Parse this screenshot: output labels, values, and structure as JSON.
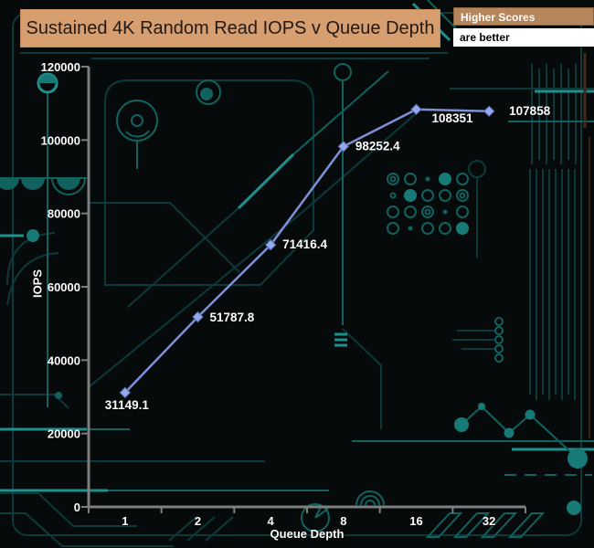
{
  "header": {
    "title": "Sustained 4K Random Read IOPS v Queue Depth",
    "legend": {
      "line1": "Higher Scores",
      "line2": "are better"
    }
  },
  "chart_data": {
    "type": "line",
    "title": "Sustained 4K Random Read IOPS v Queue Depth",
    "xlabel": "Queue Depth",
    "ylabel": "IOPS",
    "categories": [
      "1",
      "2",
      "4",
      "8",
      "16",
      "32"
    ],
    "series": [
      {
        "name": "Sustained 4K Random Read IOPS",
        "values": [
          31149.1,
          51787.8,
          71416.4,
          98252.4,
          108351,
          107858
        ]
      }
    ],
    "point_labels": [
      "31149.1",
      "51787.8",
      "71416.4",
      "98252.4",
      "108351",
      "107858"
    ],
    "ylim": [
      0,
      120000
    ],
    "y_ticks": [
      0,
      20000,
      40000,
      60000,
      80000,
      100000,
      120000
    ],
    "grid": false,
    "legend_position": "none",
    "marker": "diamond",
    "colors": {
      "line": "#7e91d8",
      "marker": "#96a9ea",
      "marker_edge": "#5b6fb8",
      "axis": "#7f7f7f",
      "label": "#ffffff",
      "title_bg": "#d79e6f",
      "title_text": "#221a12",
      "legend_header_bg": "#b5855b",
      "legend_header_text": "#ffffff",
      "legend_body_bg": "#ffffff",
      "legend_body_text": "#000000",
      "board_bg": "#060a0a",
      "trace_dim": "#0c3a3a",
      "trace_mid": "#11625f",
      "trace_bright": "#1e918d"
    }
  }
}
